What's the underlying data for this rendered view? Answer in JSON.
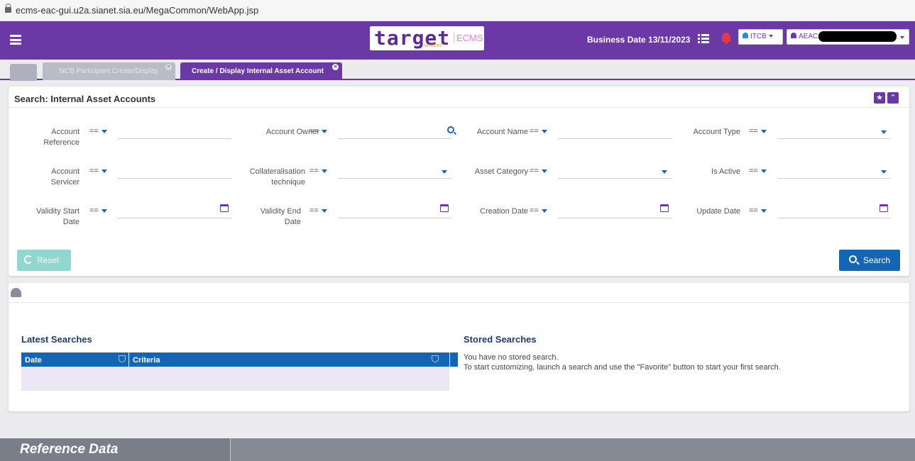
{
  "browser": {
    "url": "ecms-eac-gui.u2a.sianet.sia.eu/MegaCommon/WebApp.jsp"
  },
  "header": {
    "logo_text": "target",
    "logo_sub": "services",
    "logo_ecms": "ECMS",
    "business_date": "Business Date 13/11/2023",
    "user_itcb": "ITCB",
    "user_aeac": "AEAC-W,"
  },
  "tabs": [
    {
      "label": "NCB Participant Create/Display",
      "active": false
    },
    {
      "label": "Create / Display Internal Asset Account",
      "active": true
    }
  ],
  "search": {
    "title": "Search: Internal Asset Accounts",
    "operator": "==",
    "fields": {
      "account_reference": "Account Reference",
      "account_owner": "Account Owner",
      "account_name": "Account Name",
      "account_type": "Account Type",
      "account_servicer": "Account Servicer",
      "collateralisation_technique": "Collateralisation technique",
      "asset_category": "Asset Category",
      "is_active": "Is Active",
      "validity_start_date": "Validity Start Date",
      "validity_end_date": "Validity End Date",
      "creation_date": "Creation Date",
      "update_date": "Update Date"
    },
    "reset_label": "Reset",
    "search_label": "Search"
  },
  "history": {
    "latest_title": "Latest Searches",
    "col_date": "Date",
    "col_criteria": "Criteria",
    "stored_title": "Stored Searches",
    "stored_line1": "You have no stored search.",
    "stored_line2": "To start customizing, launch a search and use the \"Favorite\" button to start your first search."
  },
  "footer": {
    "title": "Reference Data"
  },
  "colors": {
    "brand": "#6a39a5",
    "primary": "#1565b5",
    "reset": "#8fd7cf"
  }
}
